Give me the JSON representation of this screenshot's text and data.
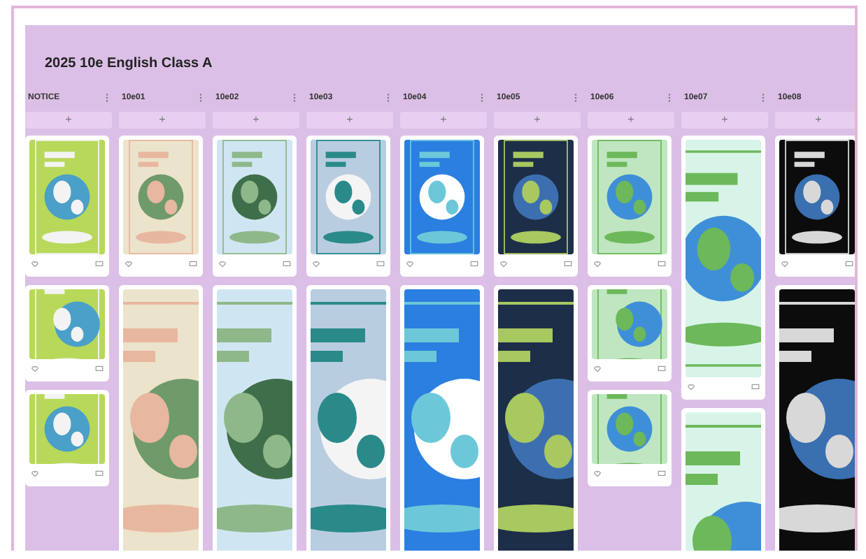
{
  "board": {
    "title": "2025 10e English Class A"
  },
  "columns": [
    {
      "title": "NOTICE",
      "add": "+",
      "cards": [
        {
          "kind": "post"
        },
        {
          "kind": "short"
        },
        {
          "kind": "short"
        }
      ]
    },
    {
      "title": "10e01",
      "add": "+",
      "cards": [
        {
          "kind": "post"
        },
        {
          "kind": "tall"
        }
      ]
    },
    {
      "title": "10e02",
      "add": "+",
      "cards": [
        {
          "kind": "post"
        },
        {
          "kind": "tall"
        }
      ]
    },
    {
      "title": "10e03",
      "add": "+",
      "cards": [
        {
          "kind": "post"
        },
        {
          "kind": "tall"
        }
      ]
    },
    {
      "title": "10e04",
      "add": "+",
      "cards": [
        {
          "kind": "post"
        },
        {
          "kind": "tall"
        }
      ]
    },
    {
      "title": "10e05",
      "add": "+",
      "cards": [
        {
          "kind": "post"
        },
        {
          "kind": "tall"
        }
      ]
    },
    {
      "title": "10e06",
      "add": "+",
      "cards": [
        {
          "kind": "post"
        },
        {
          "kind": "short"
        },
        {
          "kind": "short"
        }
      ]
    },
    {
      "title": "10e07",
      "add": "+",
      "cards": [
        {
          "kind": "long"
        },
        {
          "kind": "tall"
        }
      ]
    },
    {
      "title": "10e08",
      "add": "+",
      "cards": [
        {
          "kind": "post"
        },
        {
          "kind": "tall"
        }
      ]
    }
  ]
}
